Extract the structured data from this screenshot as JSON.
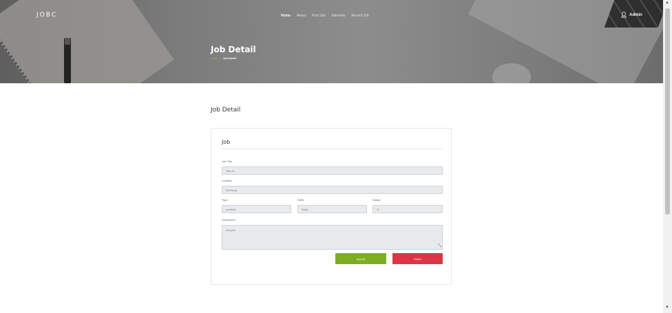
{
  "header": {
    "brand": "JOBC",
    "nav": [
      "Home",
      "About",
      "Post Job",
      "Interview",
      "Recent Job"
    ],
    "active_nav": "Home",
    "user_label": "Admin"
  },
  "hero": {
    "title": "Job Detail",
    "breadcrumb": {
      "home": "Home",
      "separator": "/",
      "current": "Job Detail"
    }
  },
  "page": {
    "section_title": "Job Detail"
  },
  "card": {
    "title": "Job",
    "fields": {
      "job_title": {
        "label": "Job Title",
        "value": "Test 12"
      },
      "location": {
        "label": "Location",
        "value": "Da Nang"
      },
      "type": {
        "label": "Type",
        "value": "parttime"
      },
      "skills": {
        "label": "Skills",
        "value": "Ruby"
      },
      "salary": {
        "label": "Salary",
        "value": "11"
      },
      "description": {
        "label": "Description",
        "value": "everyne"
      }
    },
    "accept_label": "Accept",
    "reject_label": "Reject"
  },
  "colors": {
    "accept": "#7cae22",
    "reject": "#dc3545",
    "breadcrumb_home": "#8bc34a"
  },
  "icons": {
    "user": "user-icon",
    "resize": "resize-handle-icon"
  }
}
